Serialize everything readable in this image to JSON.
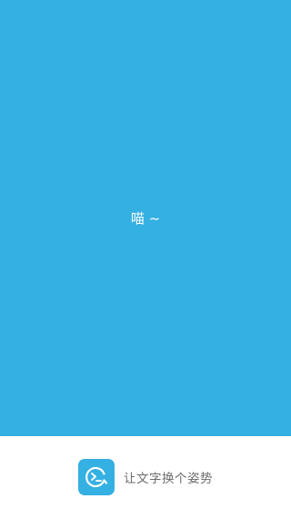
{
  "splash": {
    "message": "喵 ~",
    "background_color": "#34b0e3"
  },
  "footer": {
    "app_icon": "terminal-chat-bubble-icon",
    "tagline": "让文字换个姿势"
  }
}
